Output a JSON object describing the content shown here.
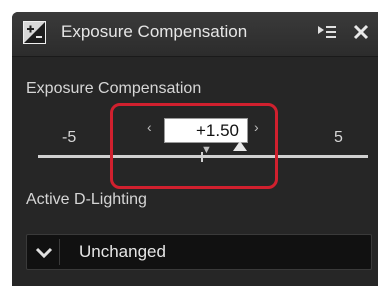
{
  "window": {
    "title": "Exposure Compensation",
    "title_icon": "exposure-plus-minus-icon",
    "menu_icon": "panel-menu-icon",
    "close_icon": "close-icon"
  },
  "exposure_compensation": {
    "label": "Exposure Compensation",
    "min_label": "-5",
    "max_label": "5",
    "value": "+1.50",
    "slider_value": 1.5,
    "range": [
      -5,
      5
    ]
  },
  "active_d_lighting": {
    "label": "Active D-Lighting",
    "selected": "Unchanged",
    "dropdown_icon": "chevron-down-icon"
  },
  "colors": {
    "panel_bg": "#262626",
    "highlight": "#d0202e",
    "text": "#d6d6d6"
  }
}
